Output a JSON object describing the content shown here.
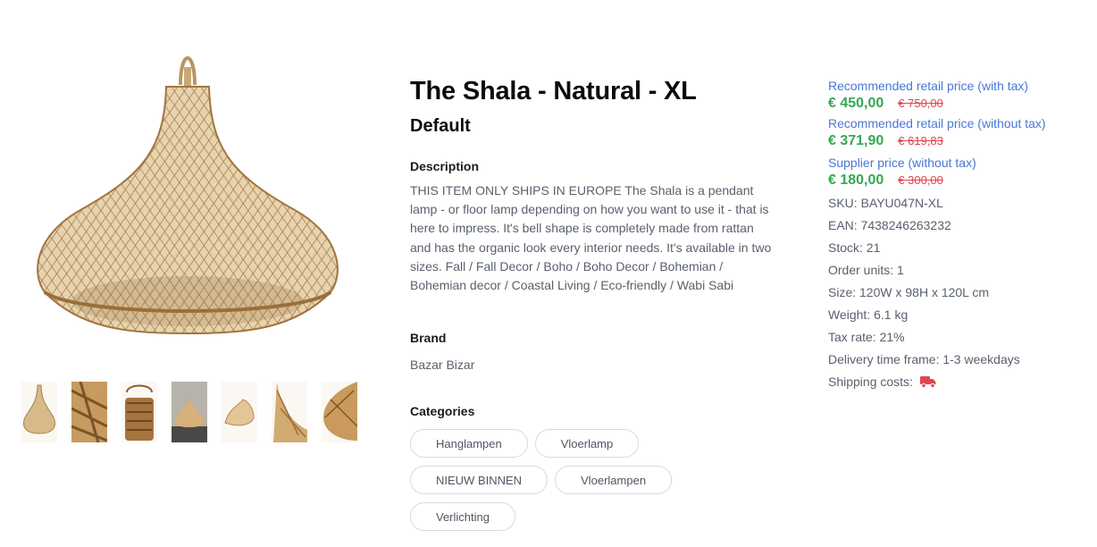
{
  "product": {
    "title": "The Shala - Natural - XL",
    "variant": "Default",
    "description_label": "Description",
    "description": "THIS ITEM ONLY SHIPS IN EUROPE The Shala is a pendant lamp - or floor lamp depending on how you want to use it - that is here to impress. It's bell shape is completely made from rattan and has the organic look every interior needs. It's available in two sizes. Fall / Fall Decor / Boho / Boho Decor / Bohemian / Bohemian decor / Coastal Living / Eco-friendly / Wabi Sabi",
    "brand_label": "Brand",
    "brand": "Bazar Bizar",
    "categories_label": "Categories",
    "categories": [
      "Hanglampen",
      "Vloerlamp",
      "NIEUW BINNEN",
      "Vloerlampen",
      "Verlichting"
    ]
  },
  "pricing": {
    "rrp_tax_label": "Recommended retail price (with tax)",
    "rrp_tax_price": "€ 450,00",
    "rrp_tax_old": "€ 750,00",
    "rrp_notax_label": "Recommended retail price (without tax)",
    "rrp_notax_price": "€ 371,90",
    "rrp_notax_old": "€ 619,83",
    "supplier_label": "Supplier price (without tax)",
    "supplier_price": "€ 180,00",
    "supplier_old": "€ 300,00"
  },
  "specs": {
    "sku": "SKU: BAYU047N-XL",
    "ean": "EAN: 7438246263232",
    "stock": "Stock: 21",
    "order_units": "Order units: 1",
    "size": "Size: 120W x 98H x 120L cm",
    "weight": "Weight: 6.1 kg",
    "tax_rate": "Tax rate: 21%",
    "delivery": "Delivery time frame: 1-3 weekdays",
    "shipping": "Shipping costs:"
  },
  "icons": {
    "shipping": "truck-icon"
  },
  "colors": {
    "price_green": "#34a853",
    "old_price_red": "#e0464e",
    "label_blue": "#4a76d4",
    "truck_red": "#e0464e"
  }
}
